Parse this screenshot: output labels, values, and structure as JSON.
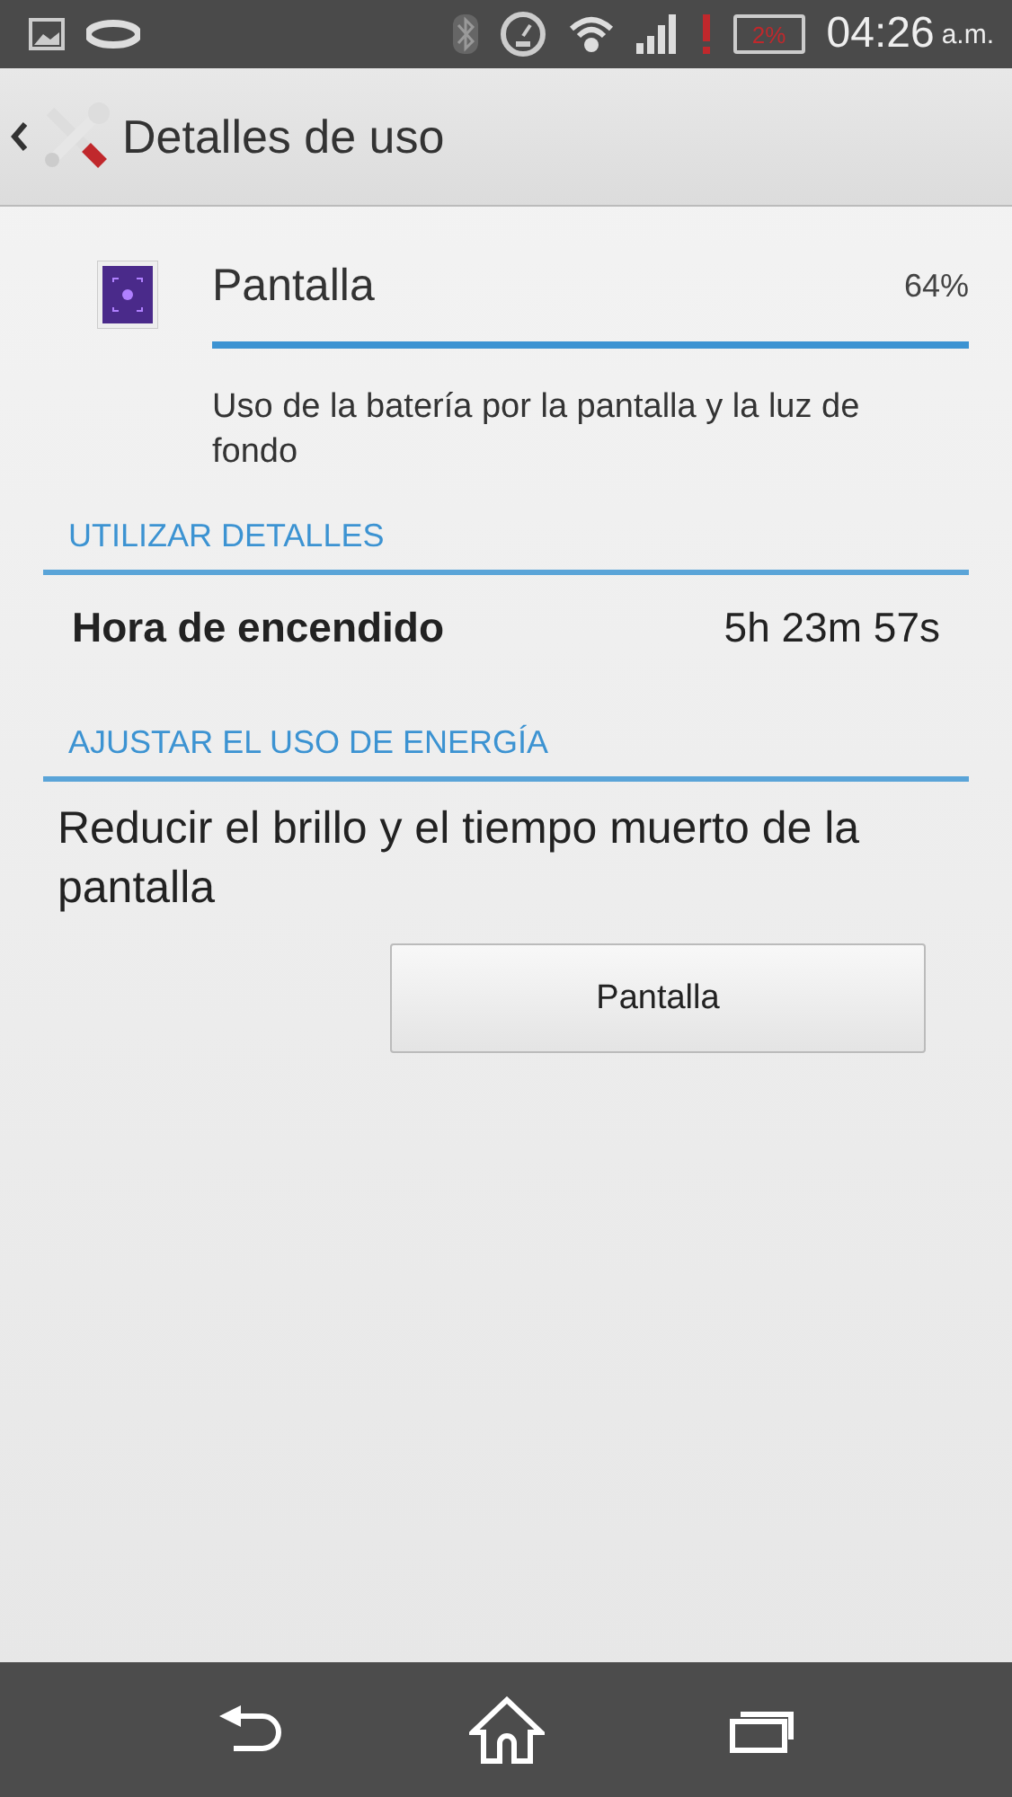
{
  "status_bar": {
    "battery": "2%",
    "time": "04:26",
    "ampm": "a.m."
  },
  "action_bar": {
    "title": "Detalles de uso"
  },
  "usage": {
    "name": "Pantalla",
    "percent": "64%",
    "level": 1,
    "description": "Uso de la batería por la pantalla y la luz de fondo"
  },
  "sections": [
    {
      "header": "UTILIZAR DETALLES",
      "rows": [
        {
          "label": "Hora de encendido",
          "value": "5h 23m 57s"
        }
      ]
    },
    {
      "header": "AJUSTAR EL USO DE ENERGÍA",
      "text": "Reducir el brillo y el tiempo muerto de la pantalla",
      "button": "Pantalla"
    }
  ]
}
